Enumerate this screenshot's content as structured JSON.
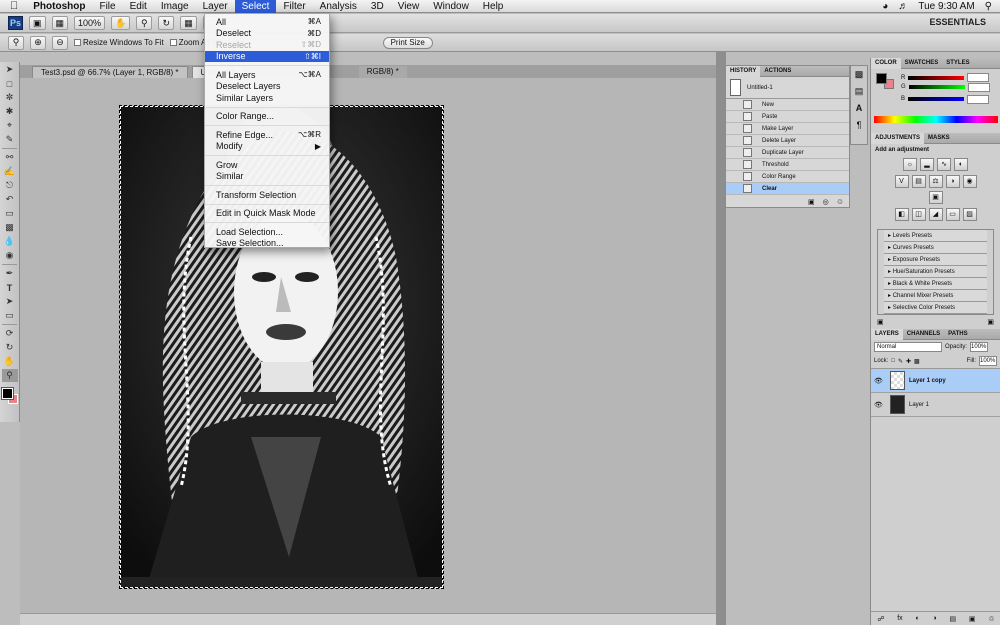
{
  "menubar": {
    "app_name": "Photoshop",
    "items": [
      "File",
      "Edit",
      "Image",
      "Layer",
      "Select",
      "Filter",
      "Analysis",
      "3D",
      "View",
      "Window",
      "Help"
    ],
    "clock": "Tue 9:30 AM"
  },
  "appbar": {
    "zoom": "100%",
    "workspace": "ESSENTIALS"
  },
  "options": {
    "resize_windows": "Resize Windows To Fit",
    "zoom_all": "Zoom All Windows",
    "print_size": "Print Size"
  },
  "doc_tabs": [
    {
      "label": "Test3.psd @ 66.7% (Layer 1, RGB/8) *"
    },
    {
      "label": "Untitled-1"
    },
    {
      "label": "RGB/8) *"
    }
  ],
  "select_menu": [
    {
      "label": "All",
      "shortcut": "⌘A",
      "state": "normal"
    },
    {
      "label": "Deselect",
      "shortcut": "⌘D",
      "state": "normal"
    },
    {
      "label": "Reselect",
      "shortcut": "⇧⌘D",
      "state": "disabled"
    },
    {
      "label": "Inverse",
      "shortcut": "⇧⌘I",
      "state": "highlighted"
    },
    {
      "label": "All Layers",
      "shortcut": "⌥⌘A",
      "state": "normal"
    },
    {
      "label": "Deselect Layers",
      "shortcut": "",
      "state": "normal"
    },
    {
      "label": "Similar Layers",
      "shortcut": "",
      "state": "normal"
    },
    {
      "label": "Color Range...",
      "shortcut": "",
      "state": "normal"
    },
    {
      "label": "Refine Edge...",
      "shortcut": "⌥⌘R",
      "state": "normal"
    },
    {
      "label": "Modify",
      "shortcut": "▶",
      "state": "normal"
    },
    {
      "label": "Grow",
      "shortcut": "",
      "state": "normal"
    },
    {
      "label": "Similar",
      "shortcut": "",
      "state": "normal"
    },
    {
      "label": "Transform Selection",
      "shortcut": "",
      "state": "normal"
    },
    {
      "label": "Edit in Quick Mask Mode",
      "shortcut": "",
      "state": "normal"
    },
    {
      "label": "Load Selection...",
      "shortcut": "",
      "state": "normal"
    },
    {
      "label": "Save Selection...",
      "shortcut": "",
      "state": "normal"
    }
  ],
  "history": {
    "tabs": [
      "HISTORY",
      "ACTIONS"
    ],
    "snapshot": "Untitled-1",
    "states": [
      "New",
      "Paste",
      "Make Layer",
      "Delete Layer",
      "Duplicate Layer",
      "Threshold",
      "Color Range",
      "Clear"
    ]
  },
  "color_panel": {
    "tabs": [
      "COLOR",
      "SWATCHES",
      "STYLES"
    ],
    "channels": [
      "R",
      "G",
      "B"
    ],
    "colors": {
      "foreground": "#000000",
      "background": "#e9838b"
    }
  },
  "adjustments": {
    "tabs": [
      "ADJUSTMENTS",
      "MASKS"
    ],
    "heading": "Add an adjustment",
    "presets": [
      "Levels Presets",
      "Curves Presets",
      "Exposure Presets",
      "Hue/Saturation Presets",
      "Black & White Presets",
      "Channel Mixer Presets",
      "Selective Color Presets"
    ]
  },
  "layers": {
    "tabs": [
      "LAYERS",
      "CHANNELS",
      "PATHS"
    ],
    "blend_mode": "Normal",
    "opacity_label": "Opacity:",
    "opacity": "100%",
    "lock_label": "Lock:",
    "fill_label": "Fill:",
    "fill": "100%",
    "items": [
      {
        "name": "Layer 1 copy",
        "selected": true
      },
      {
        "name": "Layer 1",
        "selected": false
      }
    ]
  }
}
